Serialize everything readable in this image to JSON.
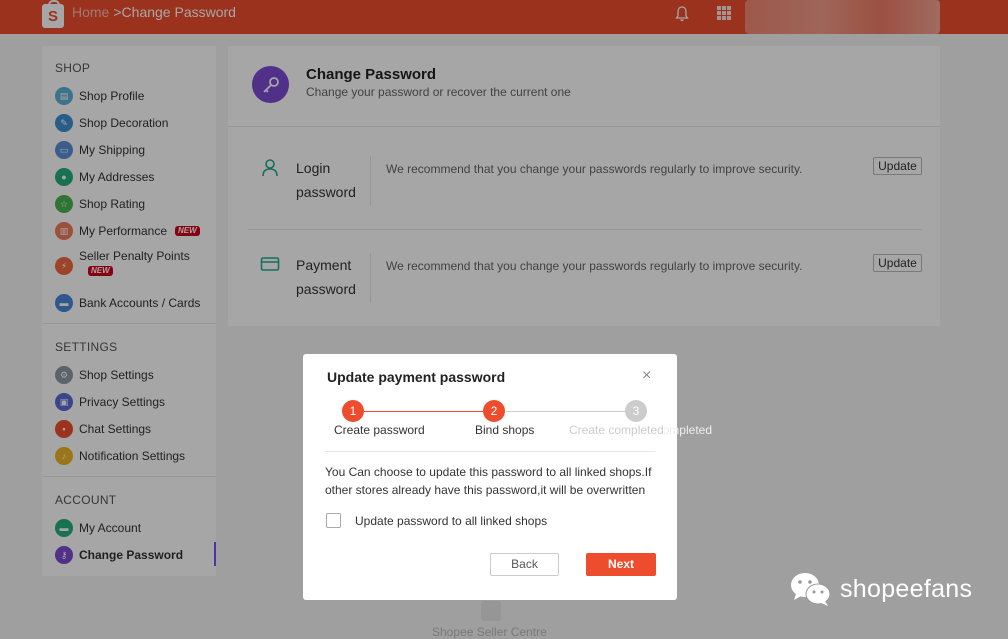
{
  "topbar": {
    "logo_letter": "S",
    "breadcrumb_home": "Home",
    "breadcrumb_separator": ">",
    "breadcrumb_current": "Change Password",
    "bell_icon": "bell-icon",
    "apps_icon": "apps-grid-icon",
    "color": "#ee4d2d"
  },
  "sidebar": {
    "shop_title": "SHOP",
    "shop_items": [
      {
        "label": "Shop Profile",
        "icon": "shop-profile-icon",
        "color": "#5fb0d6"
      },
      {
        "label": "Shop Decoration",
        "icon": "shop-decoration-icon",
        "color": "#3d8fd1"
      },
      {
        "label": "My Shipping",
        "icon": "shipping-icon",
        "color": "#5b8fd8"
      },
      {
        "label": "My Addresses",
        "icon": "address-icon",
        "color": "#27b07a"
      },
      {
        "label": "Shop Rating",
        "icon": "star-icon",
        "color": "#49b24d"
      },
      {
        "label": "My Performance",
        "icon": "performance-icon",
        "color": "#ef7b59",
        "badge": "NEW"
      },
      {
        "label": "Seller Penalty Points",
        "icon": "penalty-icon",
        "color": "#f0673f",
        "badge": "NEW"
      },
      {
        "label": "Bank Accounts / Cards",
        "icon": "bank-card-icon",
        "color": "#4a86d6"
      }
    ],
    "settings_title": "SETTINGS",
    "settings_items": [
      {
        "label": "Shop Settings",
        "icon": "gear-icon",
        "color": "#8c9aa8"
      },
      {
        "label": "Privacy Settings",
        "icon": "lock-icon",
        "color": "#5b6ad6"
      },
      {
        "label": "Chat Settings",
        "icon": "chat-icon",
        "color": "#ee4d2d"
      },
      {
        "label": "Notification Settings",
        "icon": "notification-icon",
        "color": "#f0b429"
      }
    ],
    "account_title": "ACCOUNT",
    "account_items": [
      {
        "label": "My Account",
        "icon": "account-icon",
        "color": "#27b07a"
      },
      {
        "label": "Change Password",
        "icon": "key-icon",
        "color": "#7b4ad1",
        "active": true
      }
    ]
  },
  "main": {
    "title": "Change Password",
    "subtitle": "Change your password or recover the current one",
    "rows": [
      {
        "label": "Login password",
        "description": "We recommend that you change your passwords regularly to improve security.",
        "button": "Update",
        "icon": "user-icon"
      },
      {
        "label": "Payment password",
        "description": "We recommend that you change your passwords regularly to improve security.",
        "button": "Update",
        "icon": "card-icon"
      }
    ]
  },
  "footer": {
    "text": "Shopee Seller Centre"
  },
  "modal": {
    "title": "Update payment password",
    "close_icon": "close-icon",
    "steps": [
      {
        "number": "1",
        "label": "Create password",
        "state": "done"
      },
      {
        "number": "2",
        "label": "Bind shops",
        "state": "active"
      },
      {
        "number": "3",
        "label": "Create completed",
        "state": "pending"
      }
    ],
    "message": "You Can choose to update this password to all linked shops.If other stores already have this password,it will be overwritten",
    "checkbox_label": "Update password to all linked shops",
    "checkbox_checked": false,
    "back_label": "Back",
    "next_label": "Next",
    "accent_color": "#ee4d2d"
  },
  "watermark": {
    "text": "shopeefans",
    "icon": "wechat-icon"
  }
}
